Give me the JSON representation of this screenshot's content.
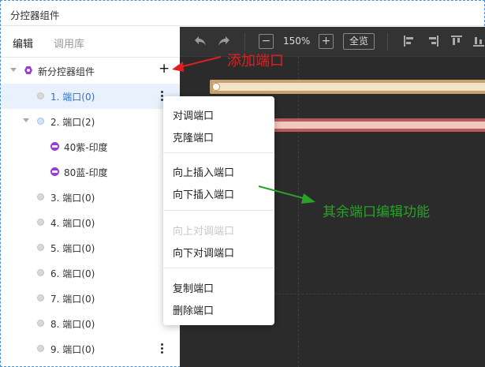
{
  "window": {
    "title": "分控器组件"
  },
  "tabs": {
    "edit": "编辑",
    "library": "调用库"
  },
  "tree": {
    "root_label": "新分控器组件",
    "add_symbol": "+",
    "items": [
      {
        "label": "1. 端口(0)"
      },
      {
        "label": "2. 端口(2)"
      },
      {
        "label": "40紫-印度"
      },
      {
        "label": "80蓝-印度"
      },
      {
        "label": "3. 端口(0)"
      },
      {
        "label": "4. 端口(0)"
      },
      {
        "label": "5. 端口(0)"
      },
      {
        "label": "6. 端口(0)"
      },
      {
        "label": "7. 端口(0)"
      },
      {
        "label": "8. 端口(0)"
      },
      {
        "label": "9. 端口(0)"
      }
    ]
  },
  "toolbar": {
    "undo_icon": "undo-icon",
    "redo_icon": "redo-icon",
    "zoom_out": "−",
    "zoom_level": "150%",
    "zoom_in": "+",
    "overview_label": "全览"
  },
  "context_menu": {
    "group1": [
      "对调端口",
      "克隆端口"
    ],
    "group2": [
      "向上插入端口",
      "向下插入端口"
    ],
    "group3": [
      "向上对调端口",
      "向下对调端口"
    ],
    "group4": [
      "复制端口",
      "删除端口"
    ]
  },
  "annotations": {
    "add_port": "添加端口",
    "other_functions": "其余端口编辑功能",
    "red": "#e02020",
    "green": "#2aa12a"
  },
  "colors": {
    "selected_row": "#e9f1fc",
    "selected_text": "#2f6fd1",
    "canvas_bg": "#2b2b2b",
    "toolbar_bg": "#333333"
  }
}
